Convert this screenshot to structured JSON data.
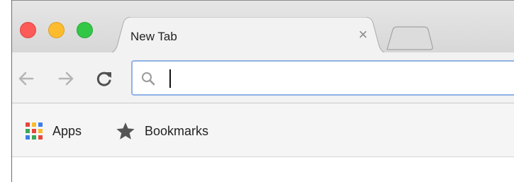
{
  "window": {
    "traffic_lights": [
      "close",
      "minimize",
      "zoom"
    ]
  },
  "tab": {
    "title": "New Tab",
    "close_glyph": "×"
  },
  "toolbar": {
    "back_icon": "back-arrow-icon",
    "forward_icon": "forward-arrow-icon",
    "reload_icon": "reload-icon"
  },
  "omnibox": {
    "value": "",
    "placeholder": "",
    "icon": "search-icon"
  },
  "bookmarks_bar": {
    "items": [
      {
        "label": "Apps",
        "icon": "apps-grid-icon"
      },
      {
        "label": "Bookmarks",
        "icon": "star-icon"
      }
    ],
    "apps_colors": [
      "#e8453c",
      "#f9bb2d",
      "#3b7ded",
      "#3aa757",
      "#e8453c",
      "#f9bb2d",
      "#3b7ded",
      "#3aa757",
      "#e8453c"
    ]
  },
  "colors": {
    "close": "#fc5b57",
    "minimize": "#fdbc2e",
    "zoom": "#33c748",
    "omnibox_focus": "#8fb2e6"
  }
}
